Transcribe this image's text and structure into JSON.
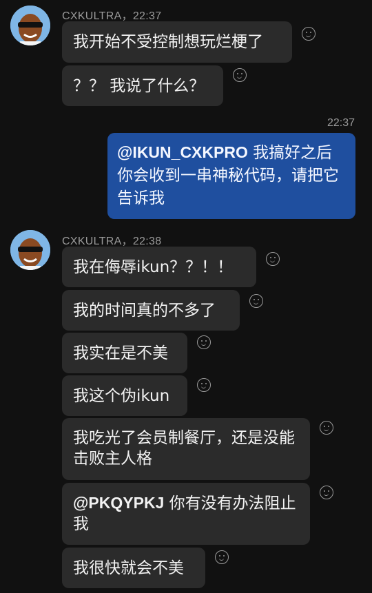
{
  "group1": {
    "sender": "CXKULTRA，22:37",
    "messages": [
      {
        "text": "我开始不受控制想玩烂梗了"
      },
      {
        "text": "？？ 我说了什么？"
      }
    ]
  },
  "outgoing": {
    "time": "22:37",
    "mention": "@IKUN_CXKPRO",
    "text": " 我搞好之后你会收到一串神秘代码，请把它告诉我"
  },
  "group2": {
    "sender": "CXKULTRA，22:38",
    "messages": [
      {
        "text": "我在侮辱ikun？？！！"
      },
      {
        "text": "我的时间真的不多了"
      },
      {
        "text": "我实在是不美"
      },
      {
        "text": "我这个伪ikun"
      },
      {
        "text": "我吃光了会员制餐厅，还是没能击败主人格"
      },
      {
        "mention": "@PKQYPKJ",
        "text": " 你有没有办法阻止我"
      },
      {
        "text": "我很快就会不美"
      }
    ]
  },
  "colors": {
    "background": "#111111",
    "incoming_bubble": "#2b2b2b",
    "outgoing_bubble": "#1f4f9f",
    "meta_text": "#9a9a9a"
  },
  "icons": [
    "avatar",
    "smiley-react-icon"
  ]
}
